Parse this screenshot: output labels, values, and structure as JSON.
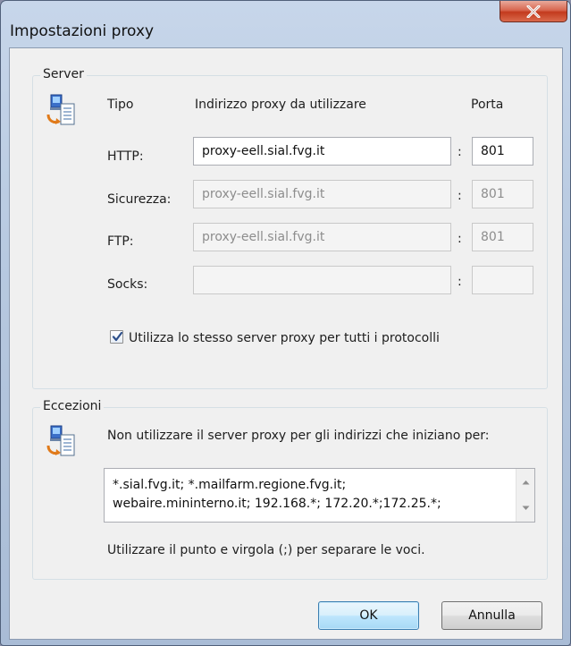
{
  "window": {
    "title": "Impostazioni proxy",
    "close_icon": "close-icon"
  },
  "server": {
    "group_label": "Server",
    "icon": "network-computer-icon",
    "col_tipo": "Tipo",
    "col_address": "Indirizzo proxy da utilizzare",
    "col_porta": "Porta",
    "rows": [
      {
        "label": "HTTP:",
        "address": "proxy-eell.sial.fvg.it",
        "port": "801",
        "enabled": true
      },
      {
        "label": "Sicurezza:",
        "address": "proxy-eell.sial.fvg.it",
        "port": "801",
        "enabled": false
      },
      {
        "label": "FTP:",
        "address": "proxy-eell.sial.fvg.it",
        "port": "801",
        "enabled": false
      },
      {
        "label": "Socks:",
        "address": "",
        "port": "",
        "enabled": false
      }
    ],
    "colon": ":",
    "same_server_label": "Utilizza lo stesso server proxy per tutti i protocolli",
    "same_server_checked": true
  },
  "exceptions": {
    "group_label": "Eccezioni",
    "icon": "network-computer-icon",
    "description": "Non utilizzare il server proxy per gli indirizzi che iniziano per:",
    "value": "*.sial.fvg.it; *.mailfarm.regione.fvg.it;\nwebaire.mininterno.it; 192.168.*; 172.20.*;172.25.*;",
    "hint": "Utilizzare il punto e virgola (;) per separare le voci."
  },
  "buttons": {
    "ok": "OK",
    "cancel": "Annulla"
  }
}
